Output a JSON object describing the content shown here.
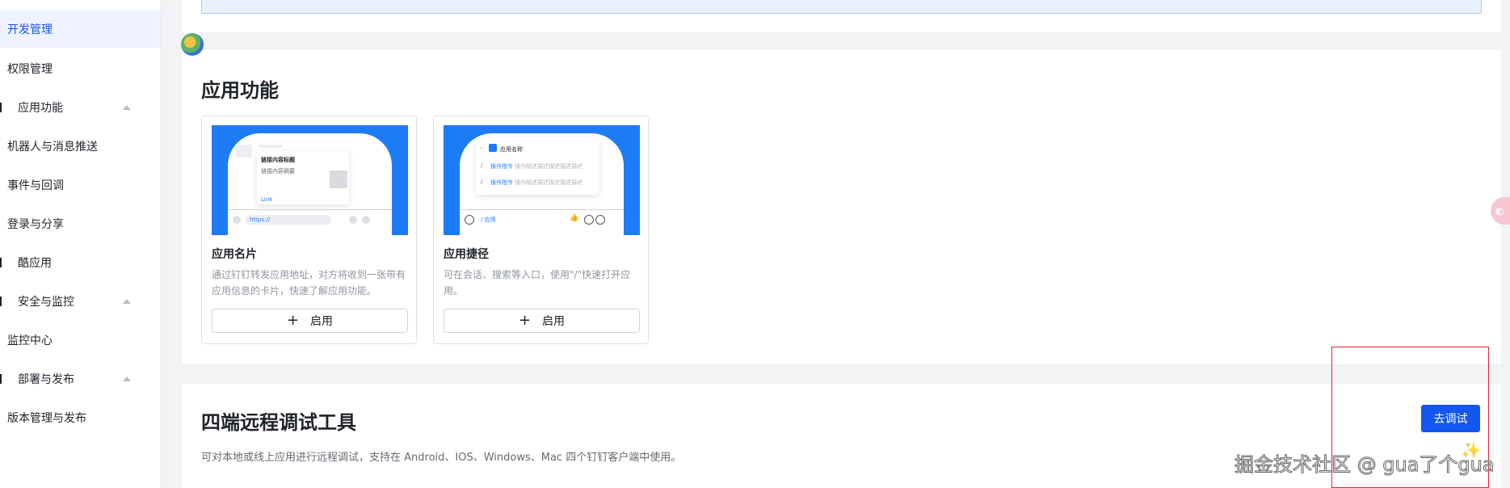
{
  "sidebar": {
    "items": [
      {
        "label": "开发管理"
      },
      {
        "label": "权限管理"
      },
      {
        "label": "应用功能"
      },
      {
        "label": "机器人与消息推送"
      },
      {
        "label": "事件与回调"
      },
      {
        "label": "登录与分享"
      },
      {
        "label": "酷应用"
      },
      {
        "label": "安全与监控"
      },
      {
        "label": "监控中心"
      },
      {
        "label": "部署与发布"
      },
      {
        "label": "版本管理与发布"
      }
    ]
  },
  "app_features": {
    "title": "应用功能",
    "cards": [
      {
        "name": "应用名片",
        "description": "通过钉钉转发应用地址，对方将收到一张带有应用信息的卡片，快速了解应用功能。",
        "button_label": "启用",
        "preview": {
          "card_title": "链接内容标题",
          "card_subtitle": "链接内容摘要",
          "link_text": "Link",
          "url_text": "https://"
        }
      },
      {
        "name": "应用捷径",
        "description": "可在会话、搜索等入口，使用\"/\"快速打开应用。",
        "button_label": "启用",
        "preview": {
          "app_name": "应用名称",
          "cmd1": "操作指令",
          "cmd1_desc": "操作描述描述描述描述描述",
          "cmd2": "操作指令",
          "cmd2_desc": "操作描述描述描述描述描述",
          "input_text": "/ 应用"
        }
      }
    ]
  },
  "remote_debug": {
    "title": "四端远程调试工具",
    "description": "可对本地或线上应用进行远程调试，支持在 Android、IOS、Windows、Mac 四个钉钉客户端中使用。",
    "button_label": "去调试"
  },
  "watermark": "掘金技术社区 @ gua了个gua",
  "colors": {
    "primary": "#1456f0",
    "highlight_box": "#e0262f",
    "preview_bg": "#1d7bf5"
  }
}
